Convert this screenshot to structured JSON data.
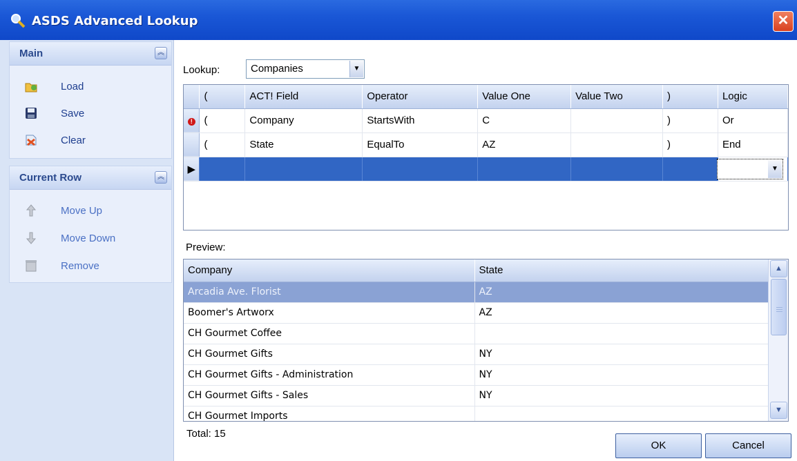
{
  "window": {
    "title": "ASDS Advanced Lookup",
    "close_glyph": "✕"
  },
  "left": {
    "main_group": {
      "title": "Main",
      "items": [
        {
          "label": "Load",
          "icon": "load-icon"
        },
        {
          "label": "Save",
          "icon": "save-icon"
        },
        {
          "label": "Clear",
          "icon": "clear-icon"
        }
      ]
    },
    "row_group": {
      "title": "Current Row",
      "items": [
        {
          "label": "Move Up",
          "icon": "move-up-icon"
        },
        {
          "label": "Move Down",
          "icon": "move-down-icon"
        },
        {
          "label": "Remove",
          "icon": "remove-icon"
        }
      ]
    }
  },
  "lookup": {
    "label": "Lookup:",
    "value": "Companies"
  },
  "criteria": {
    "headers": [
      "(",
      "ACT! Field",
      "Operator",
      "Value One",
      "Value Two",
      ")",
      "Logic"
    ],
    "rows": [
      [
        "(",
        "Company",
        "StartsWith",
        "C",
        "",
        ")",
        "Or"
      ],
      [
        "(",
        "State",
        "EqualTo",
        "AZ",
        "",
        ")",
        "End"
      ]
    ]
  },
  "preview": {
    "label": "Preview:",
    "headers": [
      "Company",
      "State"
    ],
    "rows": [
      [
        "Arcadia Ave. Florist",
        "AZ"
      ],
      [
        "Boomer's Artworx",
        "AZ"
      ],
      [
        "CH Gourmet Coffee",
        ""
      ],
      [
        "CH Gourmet Gifts",
        "NY"
      ],
      [
        "CH Gourmet Gifts - Administration",
        "NY"
      ],
      [
        "CH Gourmet Gifts - Sales",
        "NY"
      ],
      [
        "CH Gourmet Imports",
        ""
      ]
    ]
  },
  "total": "Total: 15",
  "buttons": {
    "ok": "OK",
    "cancel": "Cancel"
  },
  "colors": {
    "titlebar": "#1a57d6",
    "selection": "#3166c4",
    "panel": "#d9e4f6"
  }
}
